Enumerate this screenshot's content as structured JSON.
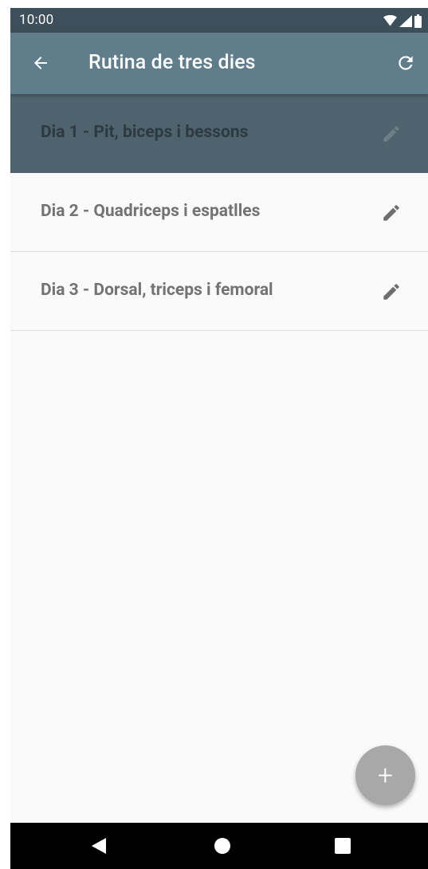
{
  "status_bar": {
    "time": "10:00"
  },
  "app_bar": {
    "title": "Rutina de tres dies",
    "back_icon": "arrow-back-icon",
    "refresh_icon": "refresh-icon"
  },
  "days": [
    {
      "label": "Dia 1 - Pit, biceps i bessons",
      "selected": true
    },
    {
      "label": "Dia 2 - Quadriceps i espatlles",
      "selected": false
    },
    {
      "label": "Dia 3 - Dorsal, triceps i femoral",
      "selected": false
    }
  ],
  "fab": {
    "label": "+"
  },
  "colors": {
    "status_bar": "#3c4f5a",
    "app_bar": "#607d8b",
    "selected_row": "#4e636e",
    "background": "#fafafa",
    "fab": "#a8a8a8"
  }
}
